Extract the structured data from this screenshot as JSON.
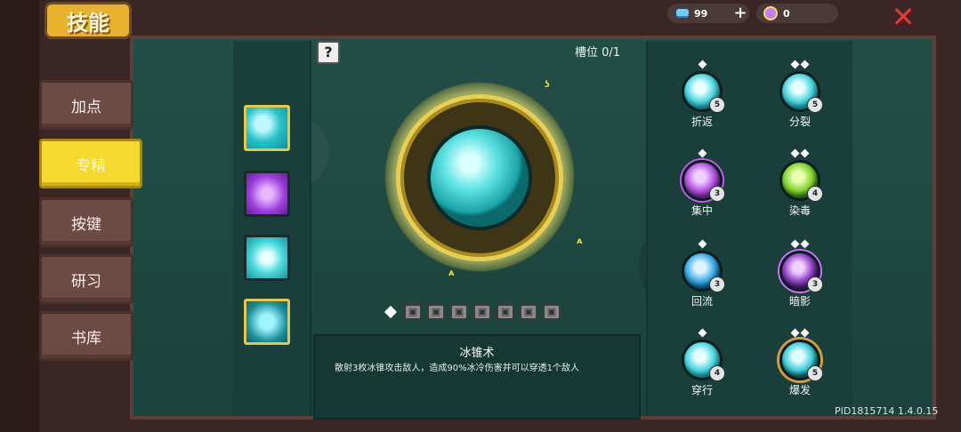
{
  "title": "技能",
  "resources": {
    "gems": "99",
    "crystals": "0",
    "add_label": "+",
    "close_label": "✕"
  },
  "side_tabs": [
    {
      "label": "加点",
      "active": false
    },
    {
      "label": "专精",
      "active": true
    },
    {
      "label": "按键",
      "active": false
    },
    {
      "label": "研习",
      "active": false
    },
    {
      "label": "书库",
      "active": false
    }
  ],
  "help_label": "?",
  "slot_label": "槽位 0/1",
  "skill": {
    "name": "冰锥术",
    "description": "散射3枚冰锥攻击敌人，造成90%冰冷伤害并可以穿透1个敌人"
  },
  "talents": [
    {
      "label": "折返",
      "level": "5",
      "pips": 1
    },
    {
      "label": "分裂",
      "level": "5",
      "pips": 2
    },
    {
      "label": "集中",
      "level": "3",
      "pips": 1
    },
    {
      "label": "染毒",
      "level": "4",
      "pips": 2
    },
    {
      "label": "回流",
      "level": "3",
      "pips": 1
    },
    {
      "label": "暗影",
      "level": "3",
      "pips": 2
    },
    {
      "label": "穿行",
      "level": "4",
      "pips": 1
    },
    {
      "label": "爆发",
      "level": "5",
      "pips": 2
    }
  ],
  "version": "PID1815714 1.4.0.15"
}
